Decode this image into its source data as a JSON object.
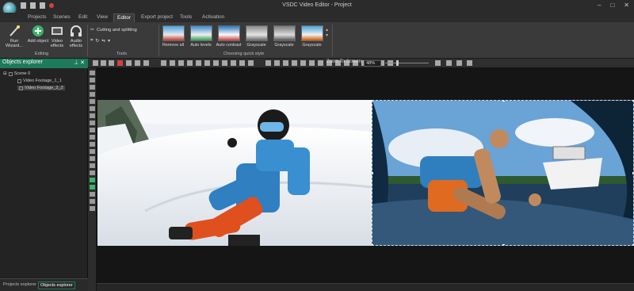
{
  "window": {
    "title": "VSDC Video Editor - Project"
  },
  "menu": {
    "tabs": [
      "Projects",
      "Scenes",
      "Edit",
      "View",
      "Editor",
      "Export project",
      "Tools",
      "Activation"
    ],
    "active": "Editor"
  },
  "ribbon": {
    "editing": {
      "run_wizard": "Run Wizard...",
      "add_object": "Add object",
      "video_effects": "Video effects",
      "audio_effects": "Audio effects",
      "group_label": "Editing"
    },
    "tools": {
      "cutting": "Cutting and splitting",
      "group_label": "Tools"
    },
    "quick_style": {
      "items": [
        "Remove all",
        "Auto levels",
        "Auto contrast",
        "Grayscale",
        "Grayscale",
        "Grayscale"
      ],
      "group_label": "Choosing quick style"
    }
  },
  "explorer": {
    "title": "Objects explorer",
    "tree": {
      "scene": "Scene 0",
      "items": [
        "Video Footage_1_1",
        "Video Footage_2_2"
      ]
    },
    "bottom_tabs": [
      "Projects explorer",
      "Objects explorer"
    ],
    "active_tab": "Objects explorer"
  },
  "toolbar": {
    "zoom_label": "Zoom To Screen",
    "zoom_value": "48%"
  },
  "colors": {
    "accent": "#1d7a5a",
    "ribbon": "#3a3a3a",
    "background": "#232323"
  }
}
